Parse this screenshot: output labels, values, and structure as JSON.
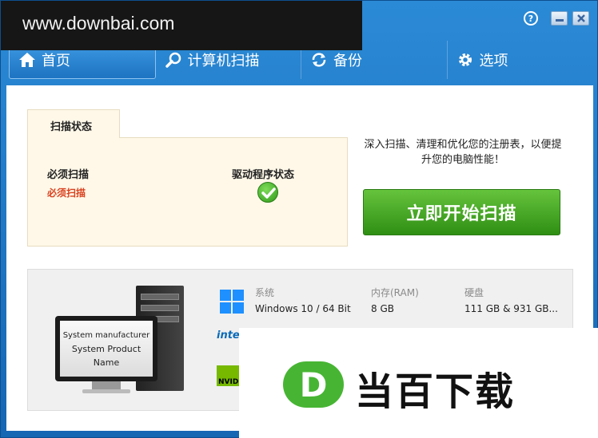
{
  "watermark": {
    "site": "www.downbai.com",
    "brand_letter": "D",
    "brand_name": "当百下载"
  },
  "titlebar": {
    "help": "?"
  },
  "nav": [
    {
      "label": "首页",
      "icon": "home-icon"
    },
    {
      "label": "计算机扫描",
      "icon": "search-icon"
    },
    {
      "label": "备份",
      "icon": "backup-icon"
    },
    {
      "label": "选项",
      "icon": "gear-icon"
    }
  ],
  "status": {
    "tab": "扫描状态",
    "scan_heading": "必须扫描",
    "scan_value": "必须扫描",
    "driver_heading": "驱动程序状态"
  },
  "description": "深入扫描、清理和优化您的注册表，以便提升您的电脑性能！",
  "scan_button": "立即开始扫描",
  "system": {
    "screen_line1": "System manufacturer",
    "screen_line2": "System Product",
    "screen_line3": "Name",
    "os_label": "系统",
    "os_value": "Windows 10 / 64 Bit",
    "ram_label": "内存(RAM)",
    "ram_value": "8 GB",
    "disk_label": "硬盘",
    "disk_value": "111 GB & 931 GB...",
    "intel": "intel",
    "nvidia": "NVIDIA"
  },
  "colors": {
    "accent": "#1d74c2",
    "scan_green": "#3fa41f",
    "warning": "#d9411e"
  }
}
